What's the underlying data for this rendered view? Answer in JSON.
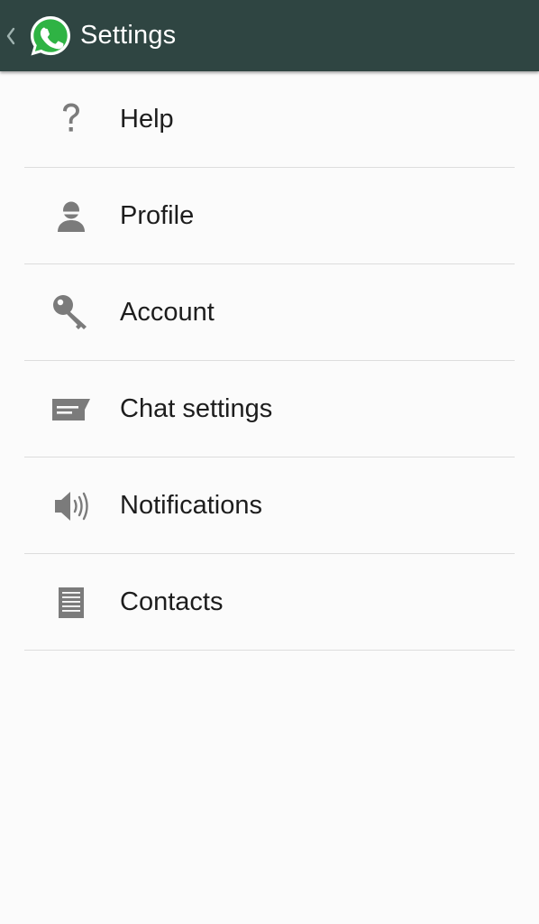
{
  "action_bar": {
    "title": "Settings",
    "back_icon": "chevron-left-icon",
    "logo_icon": "whatsapp-logo-icon",
    "background_color": "#2f4542",
    "logo_color": "#2fb344"
  },
  "menu": {
    "items": [
      {
        "label": "Help",
        "icon": "help-icon"
      },
      {
        "label": "Profile",
        "icon": "profile-icon"
      },
      {
        "label": "Account",
        "icon": "key-icon"
      },
      {
        "label": "Chat settings",
        "icon": "chat-icon"
      },
      {
        "label": "Notifications",
        "icon": "speaker-icon"
      },
      {
        "label": "Contacts",
        "icon": "contacts-list-icon"
      }
    ]
  },
  "colors": {
    "icon_gray": "#7b7b7b",
    "divider": "#dddddd",
    "text": "#1d1d1d"
  }
}
